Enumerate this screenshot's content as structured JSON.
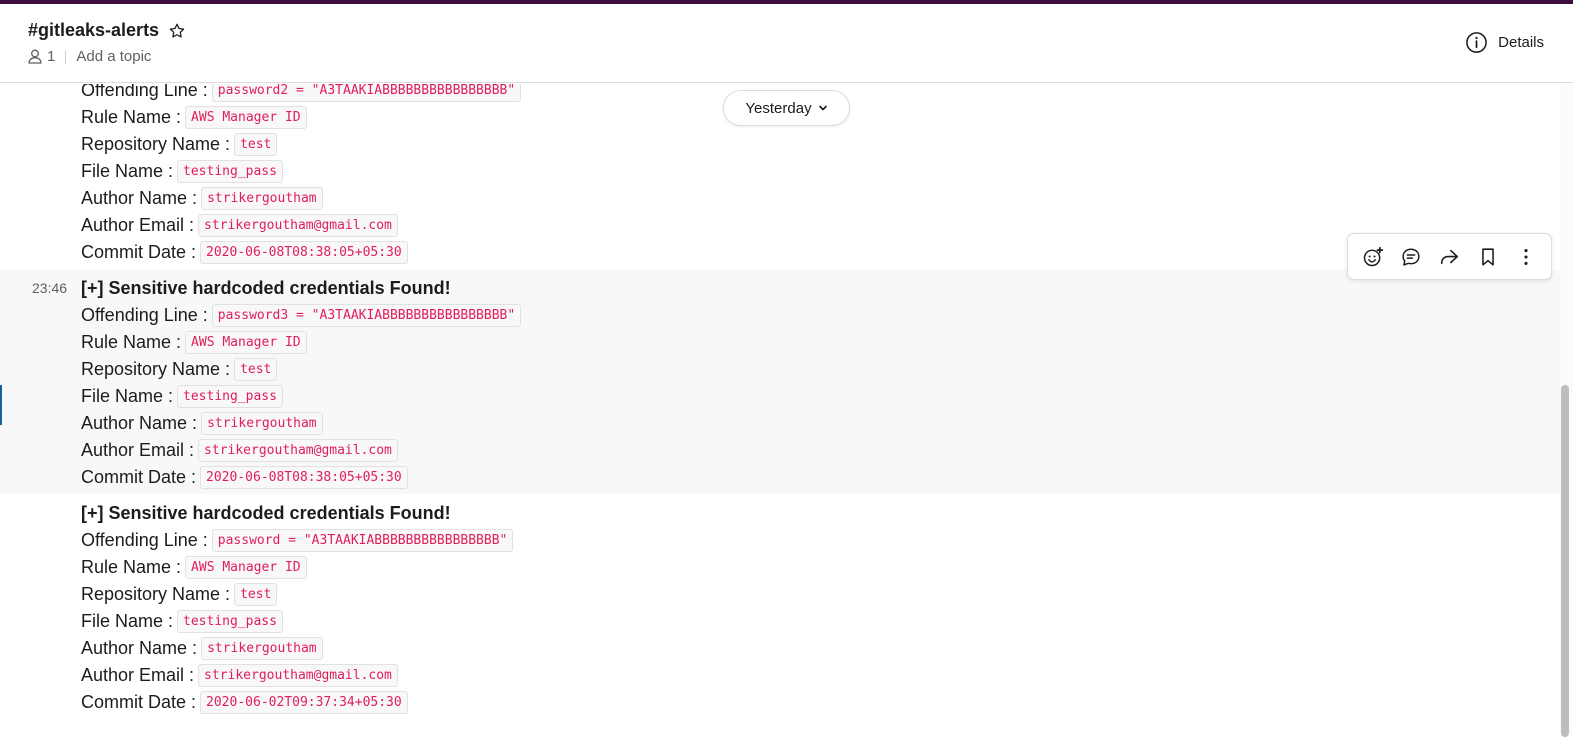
{
  "header": {
    "channel_name": "#gitleaks-alerts",
    "member_count": "1",
    "topic_placeholder": "Add a topic",
    "details_label": "Details"
  },
  "date_divider": {
    "label": "Yesterday"
  },
  "messages": [
    {
      "time": "",
      "title": "",
      "fields": [
        {
          "label": "Offending Line :",
          "value": "password2 = \"A3TAAKIABBBBBBBBBBBBBBBB\""
        },
        {
          "label": "Rule Name :",
          "value": "AWS Manager ID"
        },
        {
          "label": "Repository Name :",
          "value": "test"
        },
        {
          "label": "File Name :",
          "value": "testing_pass"
        },
        {
          "label": "Author Name :",
          "value": "strikergoutham"
        },
        {
          "label": "Author Email :",
          "value": "strikergoutham@gmail.com"
        },
        {
          "label": "Commit Date :",
          "value": "2020-06-08T08:38:05+05:30"
        }
      ]
    },
    {
      "time": "23:46",
      "title": "[+] Sensitive hardcoded credentials Found!",
      "fields": [
        {
          "label": "Offending Line :",
          "value": "password3 = \"A3TAAKIABBBBBBBBBBBBBBBB\""
        },
        {
          "label": "Rule Name :",
          "value": "AWS Manager ID"
        },
        {
          "label": "Repository Name :",
          "value": "test"
        },
        {
          "label": "File Name :",
          "value": "testing_pass"
        },
        {
          "label": "Author Name :",
          "value": "strikergoutham"
        },
        {
          "label": "Author Email :",
          "value": "strikergoutham@gmail.com"
        },
        {
          "label": "Commit Date :",
          "value": "2020-06-08T08:38:05+05:30"
        }
      ]
    },
    {
      "time": "",
      "title": "[+] Sensitive hardcoded credentials Found!",
      "fields": [
        {
          "label": "Offending Line :",
          "value": "password = \"A3TAAKIABBBBBBBBBBBBBBBB\""
        },
        {
          "label": "Rule Name :",
          "value": "AWS Manager ID"
        },
        {
          "label": "Repository Name :",
          "value": "test"
        },
        {
          "label": "File Name :",
          "value": "testing_pass"
        },
        {
          "label": "Author Name :",
          "value": "strikergoutham"
        },
        {
          "label": "Author Email :",
          "value": "strikergoutham@gmail.com"
        },
        {
          "label": "Commit Date :",
          "value": "2020-06-02T09:37:34+05:30"
        }
      ]
    }
  ],
  "message_actions": [
    "add-reaction-icon",
    "reply-in-thread-icon",
    "share-message-icon",
    "save-bookmark-icon",
    "more-actions-icon"
  ],
  "colors": {
    "accent": "#3f0e40",
    "code_text": "#e01e5a",
    "link_blue": "#1264a3"
  }
}
